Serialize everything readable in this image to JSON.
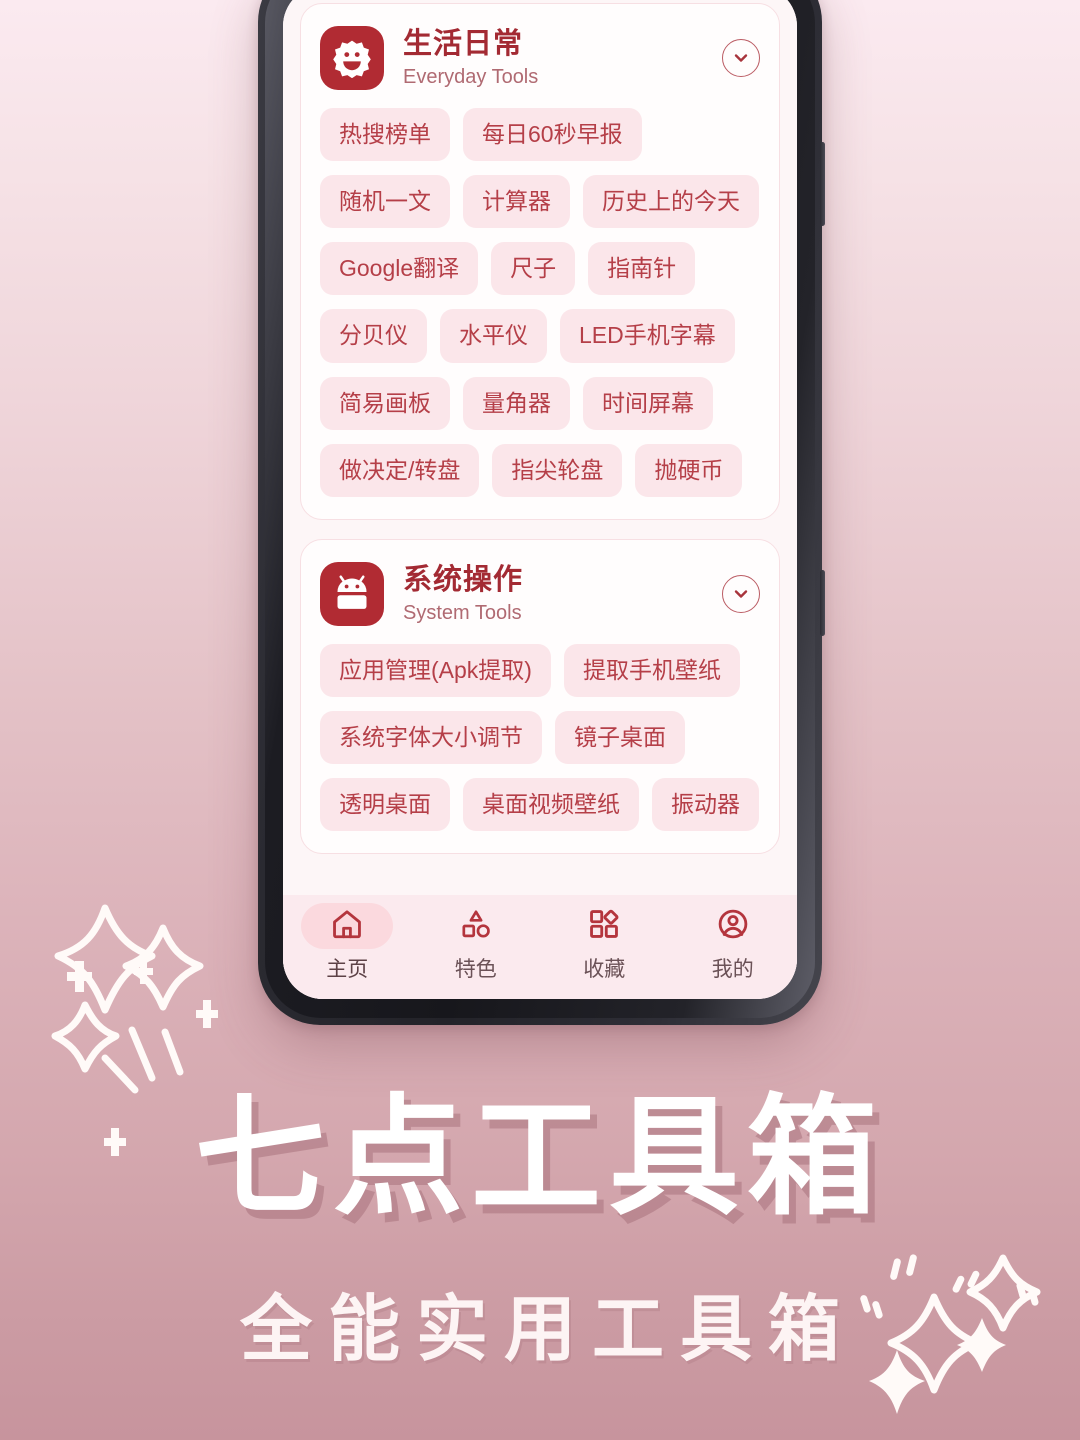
{
  "promo": {
    "title": "七点工具箱",
    "subtitle": "全能实用工具箱"
  },
  "device": {
    "frame_color": "#23232a",
    "screen_bg": "#fdf6f7",
    "buttons": [
      {
        "name": "volume-rocker"
      },
      {
        "name": "power-button"
      }
    ]
  },
  "theme": {
    "brand_red": "#b12b33",
    "title_red": "#a32a33",
    "chip_bg": "#fbe6ea",
    "chip_text": "#b53f48",
    "card_bg": "#fffdfd",
    "card_border": "#f7dfe3",
    "nav_bg": "#fbeaee",
    "nav_active_pill": "#fbd9de",
    "bg_gradient_top": "#fbeaf0",
    "bg_gradient_bottom": "#c7949d"
  },
  "app": {
    "sections": [
      {
        "icon": "flower-face-icon",
        "title_cn": "生活日常",
        "title_en": "Everyday Tools",
        "collapse_icon": "chevron-down-icon",
        "chips": [
          "热搜榜单",
          "每日60秒早报",
          "随机一文",
          "计算器",
          "历史上的今天",
          "Google翻译",
          "尺子",
          "指南针",
          "分贝仪",
          "水平仪",
          "LED手机字幕",
          "简易画板",
          "量角器",
          "时间屏幕",
          "做决定/转盘",
          "指尖轮盘",
          "抛硬币"
        ]
      },
      {
        "icon": "android-robot-icon",
        "title_cn": "系统操作",
        "title_en": "System Tools",
        "collapse_icon": "chevron-down-icon",
        "chips": [
          "应用管理(Apk提取)",
          "提取手机壁纸",
          "系统字体大小调节",
          "镜子桌面",
          "透明桌面",
          "桌面视频壁纸",
          "振动器"
        ]
      }
    ],
    "nav": {
      "items": [
        {
          "label": "主页",
          "icon": "home-icon",
          "active": true
        },
        {
          "label": "特色",
          "icon": "shapes-icon",
          "active": false
        },
        {
          "label": "收藏",
          "icon": "grid-diamond-icon",
          "active": false
        },
        {
          "label": "我的",
          "icon": "user-circle-icon",
          "active": false
        }
      ]
    }
  }
}
